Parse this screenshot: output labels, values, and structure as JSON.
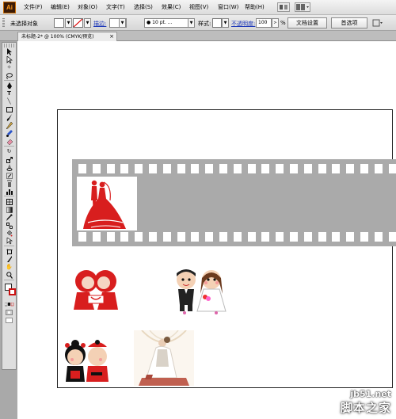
{
  "app": {
    "logo": "Ai"
  },
  "menu": [
    {
      "label": "文件(F)"
    },
    {
      "label": "编辑(E)"
    },
    {
      "label": "对象(O)"
    },
    {
      "label": "文字(T)"
    },
    {
      "label": "选择(S)"
    },
    {
      "label": "效果(C)"
    },
    {
      "label": "视图(V)"
    },
    {
      "label": "窗口(W)"
    },
    {
      "label": "帮助(H)"
    }
  ],
  "control_bar": {
    "selection_status": "未选择对象",
    "stroke_label": "描边:",
    "brush_value": "10 pt. ...",
    "style_label": "样式:",
    "opacity_label": "不透明度:",
    "opacity_value": "100",
    "opacity_unit": "%",
    "doc_setup_button": "文档设置",
    "preferences_button": "首选项"
  },
  "document_tab": {
    "title": "未标题-2* @ 100% (CMYK/预览)",
    "close": "×"
  },
  "tools": [
    "selection-tool",
    "direct-selection-tool",
    "magic-wand-tool",
    "lasso-tool",
    "pen-tool",
    "type-tool",
    "line-tool",
    "rectangle-tool",
    "paintbrush-tool",
    "pencil-tool",
    "blob-brush-tool",
    "eraser-tool",
    "rotate-tool",
    "scale-tool",
    "warp-tool",
    "free-transform-tool",
    "symbol-sprayer-tool",
    "column-graph-tool",
    "mesh-tool",
    "gradient-tool",
    "eyedropper-tool",
    "blend-tool",
    "live-paint-bucket-tool",
    "live-paint-selection-tool",
    "artboard-tool",
    "slice-tool",
    "hand-tool",
    "zoom-tool"
  ],
  "colors": {
    "fill": "#ffffff",
    "stroke": "#cc1010",
    "film": "#aaaaaa",
    "art_red": "#d81e1e"
  },
  "watermark": {
    "site": "jb51.net",
    "title": "脚本之家"
  }
}
